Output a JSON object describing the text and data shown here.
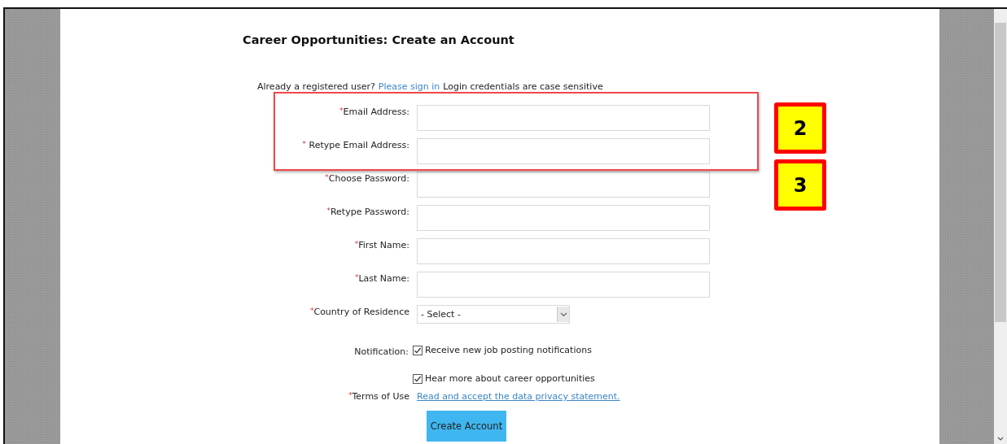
{
  "heading": "Career Opportunities: Create an Account",
  "intro": {
    "before": "Already a registered user?",
    "link": "Please sign in",
    "after": "Login credentials are case sensitive"
  },
  "fields": [
    {
      "kind": "text",
      "label": "$^{*}$Email Address:"
    },
    {
      "kind": "text",
      "label": "$^{*}$ Retype Email Address:"
    },
    {
      "kind": "text",
      "label": "$^{*}$Choose Password:"
    },
    {
      "kind": "text",
      "label": "$^{*}$Retype Password:"
    },
    {
      "kind": "text",
      "label": "$^{*}$First Name:"
    },
    {
      "kind": "text",
      "label": "$^{*}$Last Name:"
    },
    {
      "kind": "select",
      "label": "$^{*}$Country of Residence",
      "value": "- Select -"
    }
  ],
  "notification": {
    "label": "Notification:",
    "options": [
      {
        "label": "Receive new job posting notifications",
        "checked": true
      },
      {
        "label": "Hear more about career opportunities",
        "checked": true
      }
    ]
  },
  "terms": {
    "label": "$^{*}$Terms of Use",
    "link": "Read and accept the data privacy statement."
  },
  "button": "Create Account",
  "callouts": [
    "2",
    "3"
  ]
}
